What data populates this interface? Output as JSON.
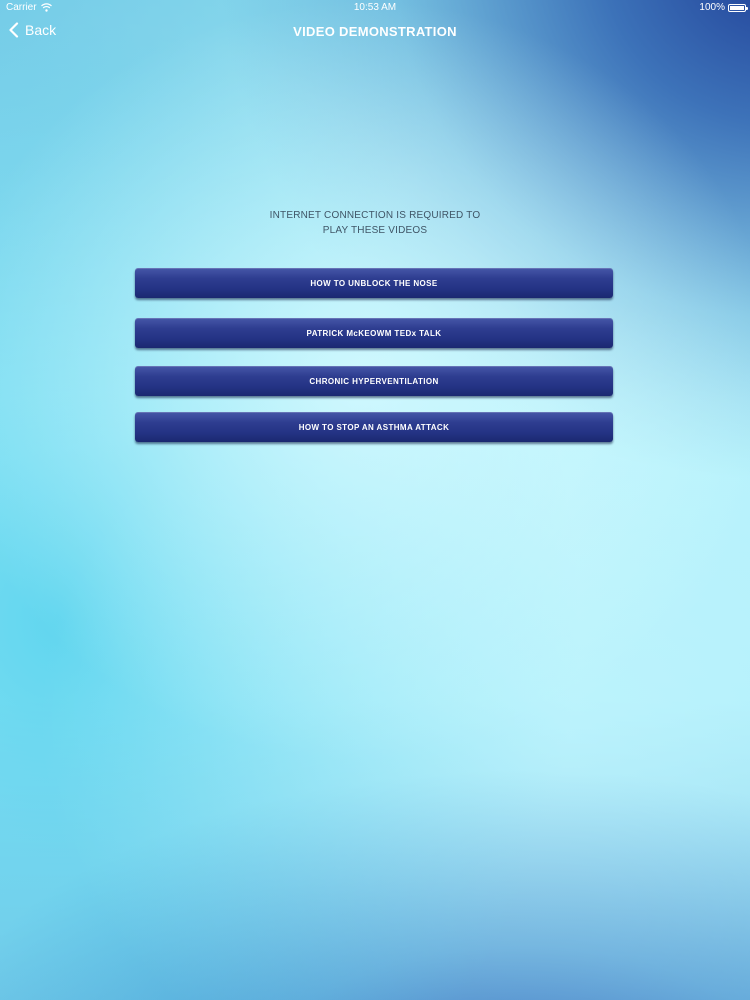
{
  "status_bar": {
    "carrier": "Carrier",
    "time": "10:53 AM",
    "battery": "100%",
    "wifi_icon": "wifi-icon",
    "battery_icon": "battery-icon"
  },
  "nav": {
    "back_label": "Back",
    "back_icon": "chevron-left-icon",
    "title": "VIDEO DEMONSTRATION"
  },
  "notice": {
    "line1": "INTERNET CONNECTION IS REQUIRED TO",
    "line2": "PLAY THESE VIDEOS"
  },
  "videos": [
    {
      "label": "HOW TO UNBLOCK THE NOSE"
    },
    {
      "label": "PATRICK McKEOWM TEDx TALK"
    },
    {
      "label": "CHRONIC HYPERVENTILATION"
    },
    {
      "label": "HOW TO STOP AN ASTHMA ATTACK"
    }
  ],
  "colors": {
    "button": "#2e3d90",
    "text_dark": "#3f5566",
    "text_light": "#ffffff"
  }
}
